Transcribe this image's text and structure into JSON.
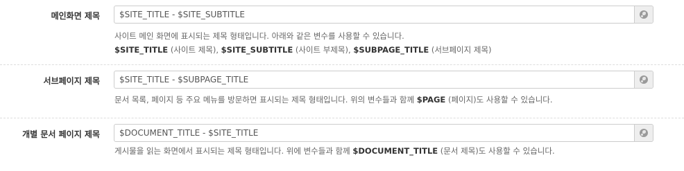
{
  "fields": [
    {
      "label": "메인화면 제목",
      "value": "$SITE_TITLE - $SITE_SUBTITLE",
      "help_line1": "사이트 메인 화면에 표시되는 제목 형태입니다. 아래와 같은 변수를 사용할 수 있습니다.",
      "var1": "$SITE_TITLE",
      "var1_desc": " (사이트 제목), ",
      "var2": "$SITE_SUBTITLE",
      "var2_desc": " (사이트 부제목), ",
      "var3": "$SUBPAGE_TITLE",
      "var3_desc": " (서브페이지 제목)"
    },
    {
      "label": "서브페이지 제목",
      "value": "$SITE_TITLE - $SUBPAGE_TITLE",
      "help_pre": "문서 목록, 페이지 등 주요 메뉴를 방문하면 표시되는 제목 형태입니다. 위의 변수들과 함께 ",
      "var": "$PAGE",
      "help_post": " (페이지)도 사용할 수 있습니다."
    },
    {
      "label": "개별 문서 페이지 제목",
      "value": "$DOCUMENT_TITLE - $SITE_TITLE",
      "help_pre": "게시물을 읽는 화면에서 표시되는 제목 형태입니다. 위에 변수들과 함께 ",
      "var": "$DOCUMENT_TITLE",
      "help_post": " (문서 제목)도 사용할 수 있습니다."
    }
  ],
  "icons": {
    "addon": "globe-icon"
  }
}
